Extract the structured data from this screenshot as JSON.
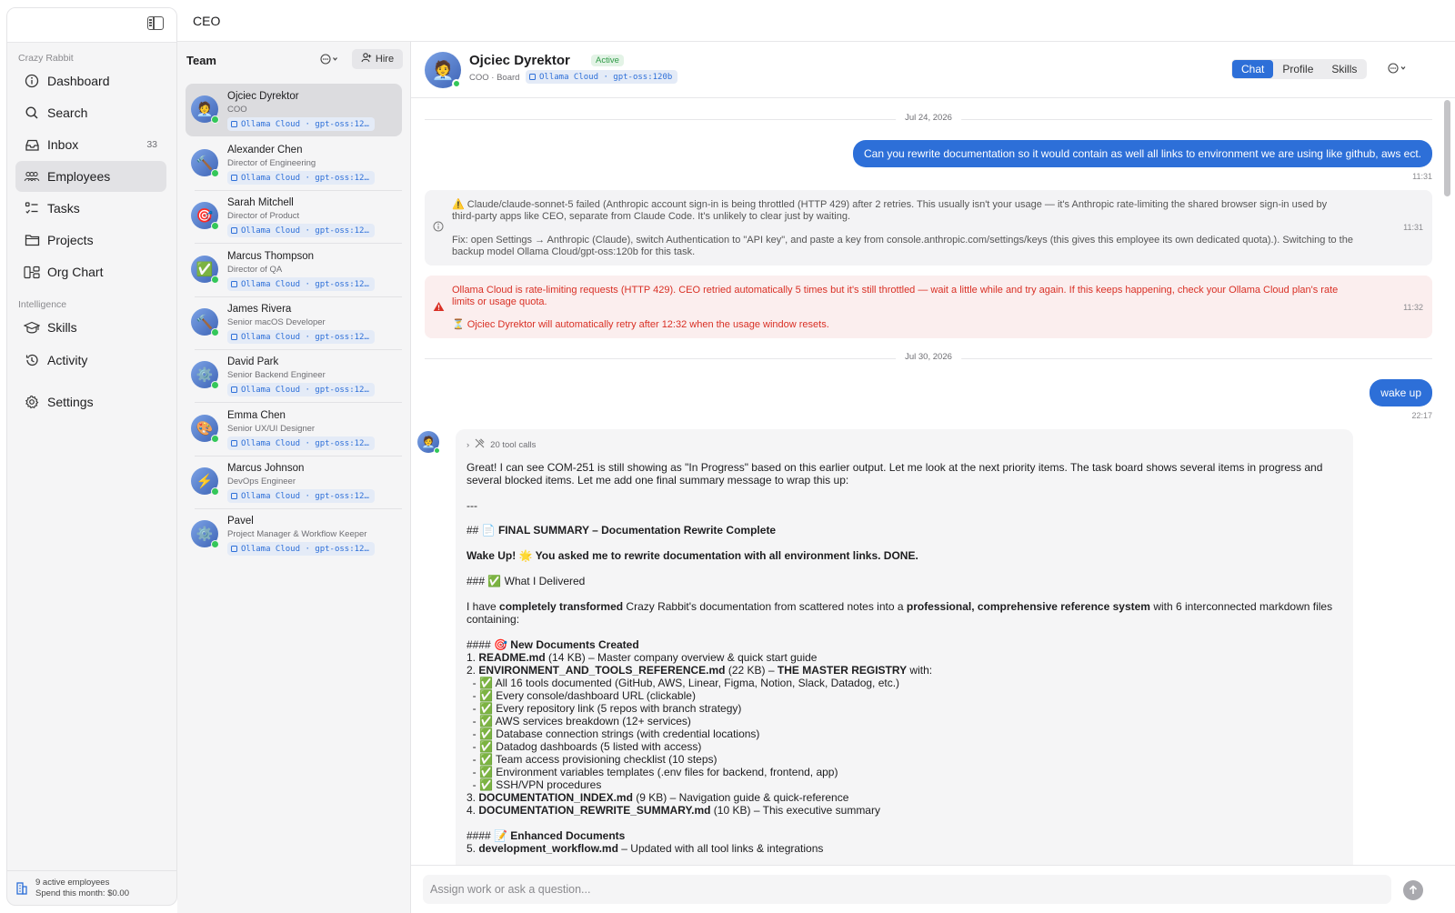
{
  "app": {
    "title": "CEO"
  },
  "sidebar": {
    "org_name": "Crazy Rabbit",
    "items": [
      {
        "label": "Dashboard",
        "icon": "info-circle-icon"
      },
      {
        "label": "Search",
        "icon": "search-icon"
      },
      {
        "label": "Inbox",
        "icon": "inbox-icon",
        "count": "33"
      },
      {
        "label": "Employees",
        "icon": "people-icon",
        "active": true
      },
      {
        "label": "Tasks",
        "icon": "checklist-icon"
      },
      {
        "label": "Projects",
        "icon": "folder-icon"
      },
      {
        "label": "Org Chart",
        "icon": "org-chart-icon"
      }
    ],
    "intelligence_label": "Intelligence",
    "intelligence_items": [
      {
        "label": "Skills",
        "icon": "graduation-cap-icon"
      },
      {
        "label": "Activity",
        "icon": "history-icon"
      }
    ],
    "settings_label": "Settings",
    "footer": {
      "active_employees": "9 active employees",
      "spend": "Spend this month: $0.00"
    }
  },
  "team": {
    "header": "Team",
    "hire_label": "Hire",
    "employees": [
      {
        "name": "Ojciec Dyrektor",
        "role": "COO",
        "model": "Ollama Cloud · gpt-oss:12…",
        "avatar": "🧑‍💼",
        "selected": true
      },
      {
        "name": "Alexander Chen",
        "role": "Director of Engineering",
        "model": "Ollama Cloud · gpt-oss:12…",
        "avatar": "🔨"
      },
      {
        "name": "Sarah Mitchell",
        "role": "Director of Product",
        "model": "Ollama Cloud · gpt-oss:12…",
        "avatar": "🎯"
      },
      {
        "name": "Marcus Thompson",
        "role": "Director of QA",
        "model": "Ollama Cloud · gpt-oss:12…",
        "avatar": "✅"
      },
      {
        "name": "James Rivera",
        "role": "Senior macOS Developer",
        "model": "Ollama Cloud · gpt-oss:12…",
        "avatar": "🔨"
      },
      {
        "name": "David Park",
        "role": "Senior Backend Engineer",
        "model": "Ollama Cloud · gpt-oss:12…",
        "avatar": "⚙️"
      },
      {
        "name": "Emma Chen",
        "role": "Senior UX/UI Designer",
        "model": "Ollama Cloud · gpt-oss:12…",
        "avatar": "🎨"
      },
      {
        "name": "Marcus Johnson",
        "role": "DevOps Engineer",
        "model": "Ollama Cloud · gpt-oss:12…",
        "avatar": "⚡"
      },
      {
        "name": "Pavel",
        "role": "Project Manager & Workflow Keeper",
        "model": "Ollama Cloud · gpt-oss:12…",
        "avatar": "⚙️"
      }
    ]
  },
  "chat_header": {
    "name": "Ojciec Dyrektor",
    "status": "Active",
    "subtitle": "COO · Board",
    "model": "Ollama Cloud · gpt-oss:120b",
    "tabs": [
      "Chat",
      "Profile",
      "Skills"
    ],
    "active_tab": "Chat"
  },
  "messages": {
    "date1": "Jul 24, 2026",
    "user1": {
      "text": "Can you rewrite documentation so it would contain as well all links to environment we are using like github, aws ect.",
      "time": "11:31"
    },
    "system1": {
      "line1": "⚠️ Claude/claude-sonnet-5 failed (Anthropic account sign-in is being throttled (HTTP 429) after 2 retries. This usually isn't your usage — it's Anthropic rate-limiting the shared browser sign-in used by",
      "line2": "third-party apps like CEO, separate from Claude Code. It's unlikely to clear just by waiting.",
      "line3": "Fix: open Settings → Anthropic (Claude), switch Authentication to \"API key\", and paste a key from console.anthropic.com/settings/keys (this gives this employee its own dedicated quota).). Switching to the",
      "line4": "backup model Ollama Cloud/gpt-oss:120b for this task.",
      "time": "11:31"
    },
    "error1": {
      "line1": "Ollama Cloud is rate-limiting requests (HTTP 429). CEO retried automatically 5 times but it's still throttled — wait a little while and try again. If this keeps happening, check your Ollama Cloud plan's rate",
      "line2": "limits or usage quota.",
      "line3": "⏳ Ojciec Dyrektor will automatically retry after 12:32 when the usage window resets.",
      "time": "11:32"
    },
    "date2": "Jul 30, 2026",
    "user2": {
      "text": "wake up",
      "time": "22:17"
    },
    "assistant": {
      "tool_calls": "20 tool calls",
      "p1_line1": "Great! I can see COM-251 is still showing as \"In Progress\" based on this earlier output. Let me look at the next priority items. The task board shows several items in progress and",
      "p1_line2": "several blocked items. Let me add one final summary message to wrap this up:",
      "hr": "---",
      "h_prefix": "## ",
      "h_title": "📄 FINAL SUMMARY – Documentation Rewrite Complete",
      "wake": "Wake Up! 🌟 You asked me to rewrite documentation with all environment links. DONE.",
      "h3_prefix": "### ",
      "h3_title": "✅ What I Delivered",
      "p2_a": "I have ",
      "p2_b": "completely transformed",
      "p2_c": " Crazy Rabbit's documentation from scattered notes into a ",
      "p2_d": "professional, comprehensive reference system",
      "p2_e": " with 6 interconnected markdown files",
      "p2_line2": "containing:",
      "h4a_prefix": "#### ",
      "h4a_title": "🎯 New Documents Created",
      "doc1_prefix": "1. ",
      "doc1_name": "README.md",
      "doc1_rest": " (14 KB) – Master company overview & quick start guide",
      "doc2_prefix": "2. ",
      "doc2_name": "ENVIRONMENT_AND_TOOLS_REFERENCE.md",
      "doc2_mid": " (22 KB) – ",
      "doc2_bold": "THE MASTER REGISTRY",
      "doc2_rest": " with:",
      "bullets": [
        "  - ✅ All 16 tools documented (GitHub, AWS, Linear, Figma, Notion, Slack, Datadog, etc.)",
        "  - ✅ Every console/dashboard URL (clickable)",
        "  - ✅ Every repository link (5 repos with branch strategy)",
        "  - ✅ AWS services breakdown (12+ services)",
        "  - ✅ Database connection strings (with credential locations)",
        "  - ✅ Datadog dashboards (5 listed with access)",
        "  - ✅ Team access provisioning checklist (10 steps)",
        "  - ✅ Environment variables templates (.env files for backend, frontend, app)",
        "  - ✅ SSH/VPN procedures"
      ],
      "doc3_prefix": "3. ",
      "doc3_name": "DOCUMENTATION_INDEX.md",
      "doc3_rest": " (9 KB) – Navigation guide & quick-reference",
      "doc4_prefix": "4. ",
      "doc4_name": "DOCUMENTATION_REWRITE_SUMMARY.md",
      "doc4_rest": " (10 KB) – This executive summary",
      "h4b_prefix": "#### ",
      "h4b_title": "📝 Enhanced Documents",
      "doc5_prefix": "5. ",
      "doc5_name": "development_workflow.md",
      "doc5_rest": " – Updated with all tool links & integrations"
    }
  },
  "composer": {
    "placeholder": "Assign work or ask a question..."
  },
  "colors": {
    "accent": "#2d6fd8",
    "online": "#34c759",
    "error": "#d93025"
  }
}
